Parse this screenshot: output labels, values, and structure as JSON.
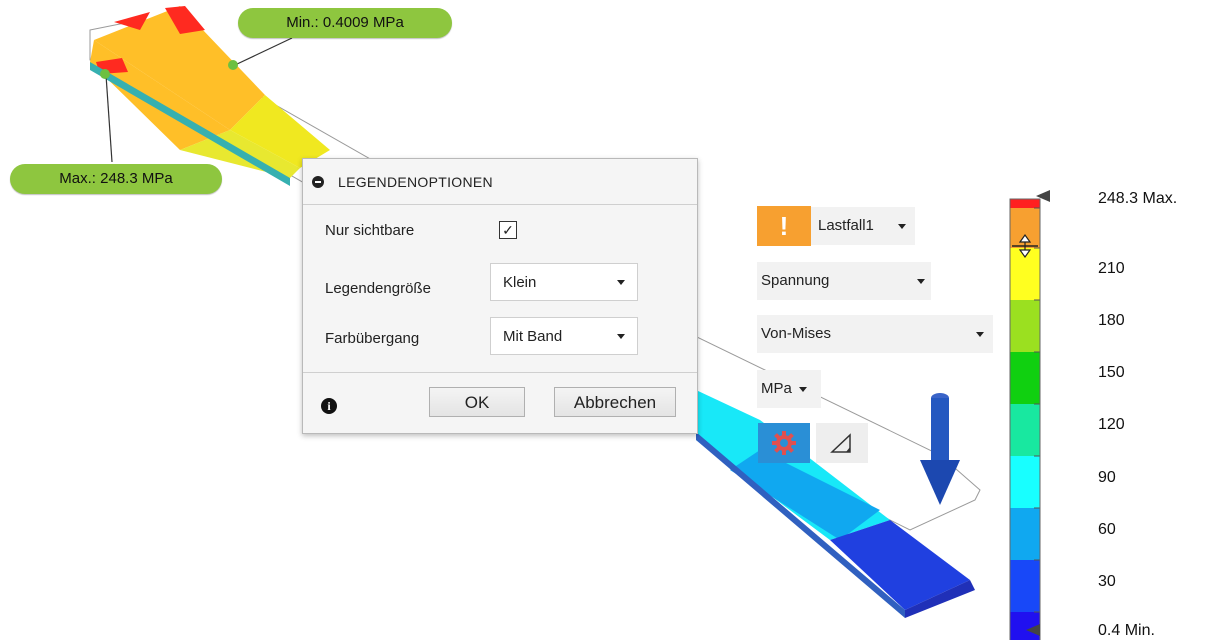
{
  "callouts": {
    "min": "Min.: 0.4009 MPa",
    "max": "Max.: 248.3 MPa"
  },
  "dialog": {
    "title": "LEGENDENOPTIONEN",
    "visible_only_label": "Nur sichtbare",
    "visible_only_checked": true,
    "legend_size_label": "Legendengröße",
    "legend_size_value": "Klein",
    "color_transition_label": "Farbübergang",
    "color_transition_value": "Mit Band",
    "ok_label": "OK",
    "cancel_label": "Abbrechen",
    "check_glyph": "✓",
    "info_glyph": "i"
  },
  "controls": {
    "warning_glyph": "!",
    "load_case": "Lastfall1",
    "result_type": "Spannung",
    "criterion": "Von-Mises",
    "unit": "MPa"
  },
  "legend": {
    "max_label": "248.3 Max.",
    "min_label": "0.4 Min.",
    "ticks": [
      "210",
      "180",
      "150",
      "120",
      "90",
      "60",
      "30"
    ],
    "bands": [
      "#ff2020",
      "#f7a030",
      "#ffff20",
      "#9be020",
      "#10d010",
      "#18e8a0",
      "#18ffff",
      "#10a8f0",
      "#1848f8",
      "#2010f0"
    ]
  },
  "icons": {
    "gear": "gear-icon",
    "triangle": "triangle-icon",
    "slider": "slider-handle-icon",
    "info": "info-icon",
    "collapse": "collapse-icon",
    "warning": "warning-icon",
    "load_arrow": "load-arrow-icon"
  },
  "colors": {
    "callout": "#8ec63f",
    "accent": "#2a8fd6",
    "warning": "#f7a030"
  }
}
